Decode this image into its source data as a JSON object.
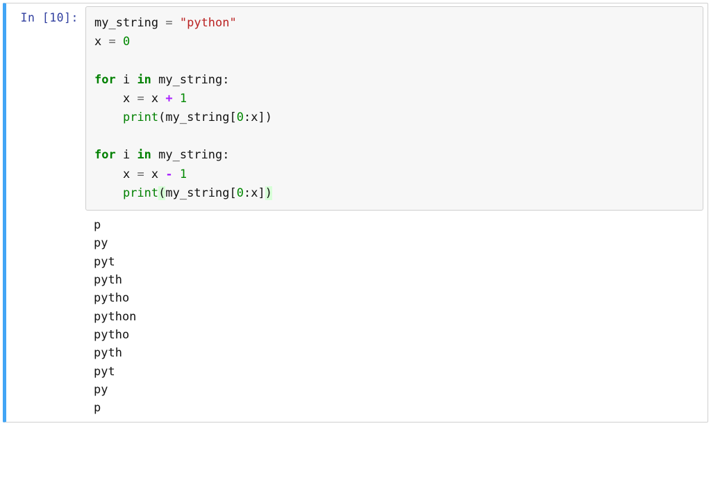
{
  "cell": {
    "prompt": "In [10]:",
    "code": {
      "l1": {
        "a": "my_string ",
        "eq": "=",
        "b": " ",
        "str": "\"python\""
      },
      "l2": {
        "a": "x ",
        "eq": "=",
        "b": " ",
        "num": "0"
      },
      "l3": "",
      "l4": {
        "kfor": "for",
        "a": " i ",
        "kin": "in",
        "b": " my_string:"
      },
      "l5": {
        "indent": "    ",
        "a": "x ",
        "eq1": "=",
        "b": " x ",
        "op": "+",
        "c": " ",
        "num": "1"
      },
      "l6": {
        "indent": "    ",
        "fn": "print",
        "a": "(my_string[",
        "num": "0",
        "b": ":x])"
      },
      "l7": "",
      "l8": {
        "kfor": "for",
        "a": " i ",
        "kin": "in",
        "b": " my_string:"
      },
      "l9": {
        "indent": "    ",
        "a": "x ",
        "eq1": "=",
        "b": " x ",
        "op": "-",
        "c": " ",
        "num": "1"
      },
      "l10": {
        "indent": "    ",
        "fn": "print",
        "open": "(",
        "a": "my_string[",
        "num": "0",
        "b": ":x]",
        "close": ")"
      }
    },
    "output_lines": [
      "p",
      "py",
      "pyt",
      "pyth",
      "pytho",
      "python",
      "pytho",
      "pyth",
      "pyt",
      "py",
      "p"
    ]
  }
}
